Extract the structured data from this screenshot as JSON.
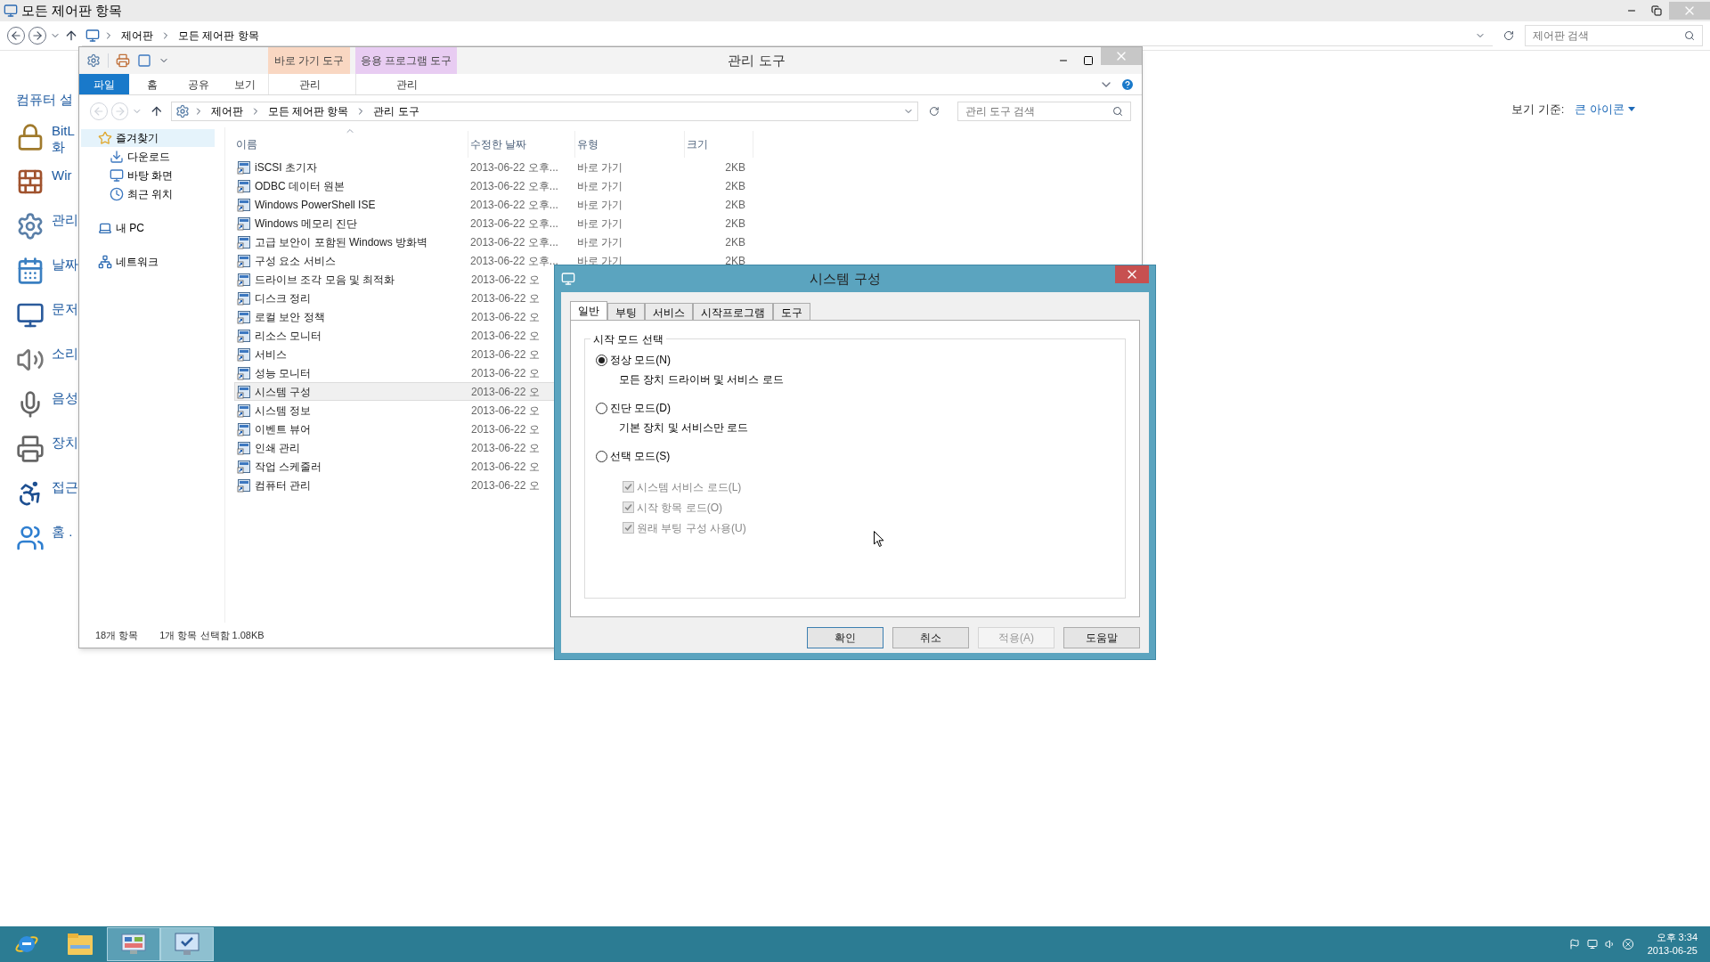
{
  "back_window": {
    "title": "모든 제어판 항목",
    "breadcrumb": [
      "제어판",
      "모든 제어판 항목"
    ],
    "search": {
      "placeholder": "제어판 검색"
    },
    "heading": "컴퓨터 설",
    "view_by": {
      "label": "보기 기준:",
      "value": "큰 아이콘"
    },
    "items": [
      {
        "lines": [
          "BitL",
          "화"
        ]
      },
      {
        "lines": [
          "Wir"
        ]
      },
      {
        "lines": [
          "관리"
        ]
      },
      {
        "lines": [
          "날짜"
        ]
      },
      {
        "lines": [
          "문저"
        ]
      },
      {
        "lines": [
          "소리"
        ]
      },
      {
        "lines": [
          "음성"
        ]
      },
      {
        "lines": [
          "장치"
        ]
      },
      {
        "lines": [
          "접근"
        ]
      },
      {
        "lines": [
          "홈 ."
        ]
      }
    ]
  },
  "explorer": {
    "title": "관리 도구",
    "context_tabs": [
      {
        "label": "바로 가기 도구",
        "tab": "관리",
        "color": "#f9d7c2"
      },
      {
        "label": "응용 프로그램 도구",
        "tab": "관리",
        "color": "#e8ccf2"
      }
    ],
    "ribbon_tabs": [
      {
        "label": "파일",
        "kind": "file"
      },
      {
        "label": "홈",
        "kind": "tab"
      },
      {
        "label": "공유",
        "kind": "tab"
      },
      {
        "label": "보기",
        "kind": "tab"
      }
    ],
    "breadcrumb": [
      "제어판",
      "모든 제어판 항목",
      "관리 도구"
    ],
    "search": {
      "placeholder": "관리 도구 검색"
    },
    "nav": [
      {
        "label": "즐겨찾기",
        "selected": true,
        "children": [
          {
            "label": "다운로드",
            "selected": false
          },
          {
            "label": "바탕 화면",
            "selected": false
          },
          {
            "label": "최근 위치",
            "selected": false
          }
        ]
      },
      {
        "label": "내 PC",
        "selected": false
      },
      {
        "label": "네트워크",
        "selected": false
      }
    ],
    "columns": [
      "이름",
      "수정한 날짜",
      "유형",
      "크기"
    ],
    "rows": [
      {
        "name": "iSCSI 초기자",
        "date": "2013-06-22 오후...",
        "type": "바로 가기",
        "size": "2KB",
        "selected": false
      },
      {
        "name": "ODBC 데이터 원본",
        "date": "2013-06-22 오후...",
        "type": "바로 가기",
        "size": "2KB",
        "selected": false
      },
      {
        "name": "Windows PowerShell ISE",
        "date": "2013-06-22 오후...",
        "type": "바로 가기",
        "size": "2KB",
        "selected": false
      },
      {
        "name": "Windows 메모리 진단",
        "date": "2013-06-22 오후...",
        "type": "바로 가기",
        "size": "2KB",
        "selected": false
      },
      {
        "name": "고급 보안이 포함된 Windows 방화벽",
        "date": "2013-06-22 오후...",
        "type": "바로 가기",
        "size": "2KB",
        "selected": false
      },
      {
        "name": "구성 요소 서비스",
        "date": "2013-06-22 오후...",
        "type": "바로 가기",
        "size": "2KB",
        "selected": false
      },
      {
        "name": "드라이브 조각 모음 및 최적화",
        "date": "2013-06-22 오",
        "selected": false
      },
      {
        "name": "디스크 정리",
        "date": "2013-06-22 오",
        "selected": false
      },
      {
        "name": "로컬 보안 정책",
        "date": "2013-06-22 오",
        "selected": false
      },
      {
        "name": "리소스 모니터",
        "date": "2013-06-22 오",
        "selected": false
      },
      {
        "name": "서비스",
        "date": "2013-06-22 오",
        "selected": false
      },
      {
        "name": "성능 모니터",
        "date": "2013-06-22 오",
        "selected": false
      },
      {
        "name": "시스템 구성",
        "date": "2013-06-22 오",
        "selected": true
      },
      {
        "name": "시스템 정보",
        "date": "2013-06-22 오",
        "selected": false
      },
      {
        "name": "이벤트 뷰어",
        "date": "2013-06-22 오",
        "selected": false
      },
      {
        "name": "인쇄 관리",
        "date": "2013-06-22 오",
        "selected": false
      },
      {
        "name": "작업 스케줄러",
        "date": "2013-06-22 오",
        "selected": false
      },
      {
        "name": "컴퓨터 관리",
        "date": "2013-06-22 오",
        "selected": false
      }
    ],
    "status": [
      "18개 항목",
      "1개 항목 선택함 1.08KB"
    ]
  },
  "dialog": {
    "title": "시스템 구성",
    "tabs": [
      {
        "label": "일반",
        "selected": true
      },
      {
        "label": "부팅",
        "selected": false
      },
      {
        "label": "서비스",
        "selected": false
      },
      {
        "label": "시작프로그램",
        "selected": false
      },
      {
        "label": "도구",
        "selected": false
      }
    ],
    "group_title": "시작 모드 선택",
    "modes": [
      {
        "label": "정상 모드(N)",
        "description": "모든 장치 드라이버 및 서비스 로드",
        "selected": true
      },
      {
        "label": "진단 모드(D)",
        "description": "기본 장치 및 서비스만 로드",
        "selected": false
      },
      {
        "label": "선택 모드(S)",
        "selected": false
      }
    ],
    "options": [
      {
        "label": "시스템 서비스 로드(L)",
        "checked": true,
        "disabled": true
      },
      {
        "label": "시작 항목 로드(O)",
        "checked": true,
        "disabled": true
      },
      {
        "label": "원래 부팅 구성 사용(U)",
        "checked": true,
        "disabled": true
      }
    ],
    "buttons": [
      {
        "label": "확인",
        "kind": "default",
        "disabled": false
      },
      {
        "label": "취소",
        "kind": "normal",
        "disabled": false
      },
      {
        "label": "적용(A)",
        "kind": "normal",
        "disabled": true
      },
      {
        "label": "도움말",
        "kind": "normal",
        "disabled": false
      }
    ]
  },
  "taskbar": {
    "apps": [
      {
        "kind": "ie",
        "running": false,
        "selected": false
      },
      {
        "kind": "explorer",
        "running": false,
        "selected": false
      },
      {
        "kind": "control",
        "running": true,
        "selected": false
      },
      {
        "kind": "msconfig",
        "running": true,
        "selected": true
      }
    ],
    "clock": {
      "time": "오후 3:34",
      "date": "2013-06-25"
    }
  }
}
